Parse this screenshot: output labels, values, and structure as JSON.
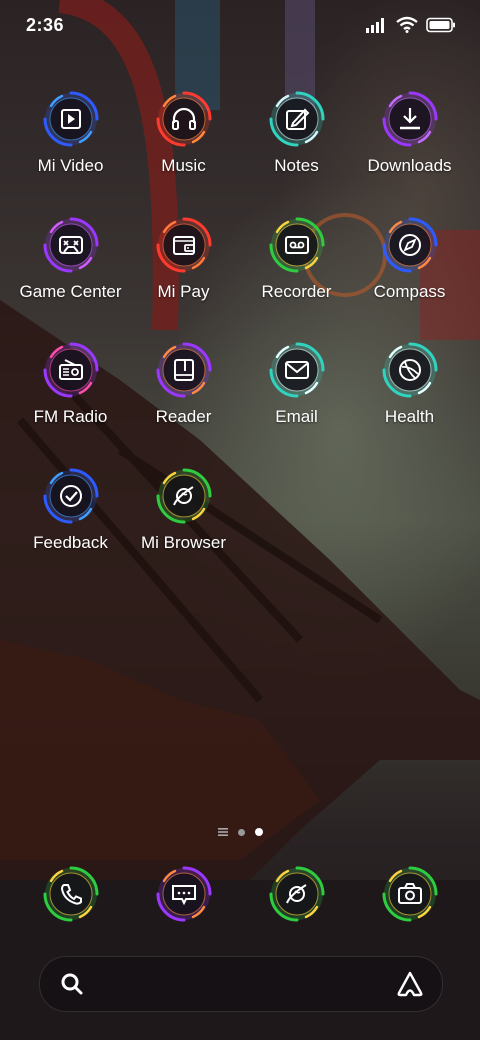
{
  "status_bar": {
    "time": "2:36",
    "icons": [
      "signal-icon",
      "wifi-icon",
      "battery-icon"
    ]
  },
  "apps": [
    {
      "label": "Mi Video",
      "icon": "play-icon",
      "ring": [
        "#2e5bff",
        "#3fa0ff"
      ]
    },
    {
      "label": "Music",
      "icon": "headphones-icon",
      "ring": [
        "#ff3b2f",
        "#ff8a3d"
      ]
    },
    {
      "label": "Notes",
      "icon": "edit-note-icon",
      "ring": [
        "#2fd3c0",
        "#d9f5ff"
      ]
    },
    {
      "label": "Downloads",
      "icon": "download-icon",
      "ring": [
        "#9b37ff",
        "#c46cff"
      ]
    },
    {
      "label": "Game Center",
      "icon": "gamepad-icon",
      "ring": [
        "#9b37ff",
        "#d05cff"
      ]
    },
    {
      "label": "Mi Pay",
      "icon": "wallet-icon",
      "ring": [
        "#ff3b2f",
        "#ff7a3d"
      ]
    },
    {
      "label": "Recorder",
      "icon": "cassette-icon",
      "ring": [
        "#2ecc40",
        "#ffd23f"
      ]
    },
    {
      "label": "Compass",
      "icon": "compass-icon",
      "ring": [
        "#2e5bff",
        "#ff8a3d"
      ]
    },
    {
      "label": "FM Radio",
      "icon": "radio-icon",
      "ring": [
        "#9b37ff",
        "#ff4fa8"
      ]
    },
    {
      "label": "Reader",
      "icon": "book-icon",
      "ring": [
        "#9b37ff",
        "#ff8a3d"
      ]
    },
    {
      "label": "Email",
      "icon": "mail-icon",
      "ring": [
        "#2fd3c0",
        "#e8ffff"
      ]
    },
    {
      "label": "Health",
      "icon": "heart-circle-icon",
      "ring": [
        "#2fd3c0",
        "#e8ffff"
      ]
    },
    {
      "label": "Feedback",
      "icon": "check-circle-icon",
      "ring": [
        "#2e5bff",
        "#3fa0ff"
      ]
    },
    {
      "label": "Mi Browser",
      "icon": "planet-icon",
      "ring": [
        "#2ecc40",
        "#ffd23f"
      ]
    }
  ],
  "dock": [
    {
      "name": "phone",
      "icon": "phone-icon",
      "ring": [
        "#2ecc40",
        "#ffd23f"
      ]
    },
    {
      "name": "messages",
      "icon": "chat-icon",
      "ring": [
        "#9b37ff",
        "#ff8a3d"
      ]
    },
    {
      "name": "browser",
      "icon": "planet-icon",
      "ring": [
        "#2ecc40",
        "#ffd23f"
      ]
    },
    {
      "name": "camera",
      "icon": "camera-icon",
      "ring": [
        "#2ecc40",
        "#ffd23f"
      ]
    }
  ],
  "page_indicator": {
    "pages": 3,
    "current": 2
  },
  "search": {
    "left_icon": "search-icon",
    "right_icon": "assistant-icon"
  }
}
